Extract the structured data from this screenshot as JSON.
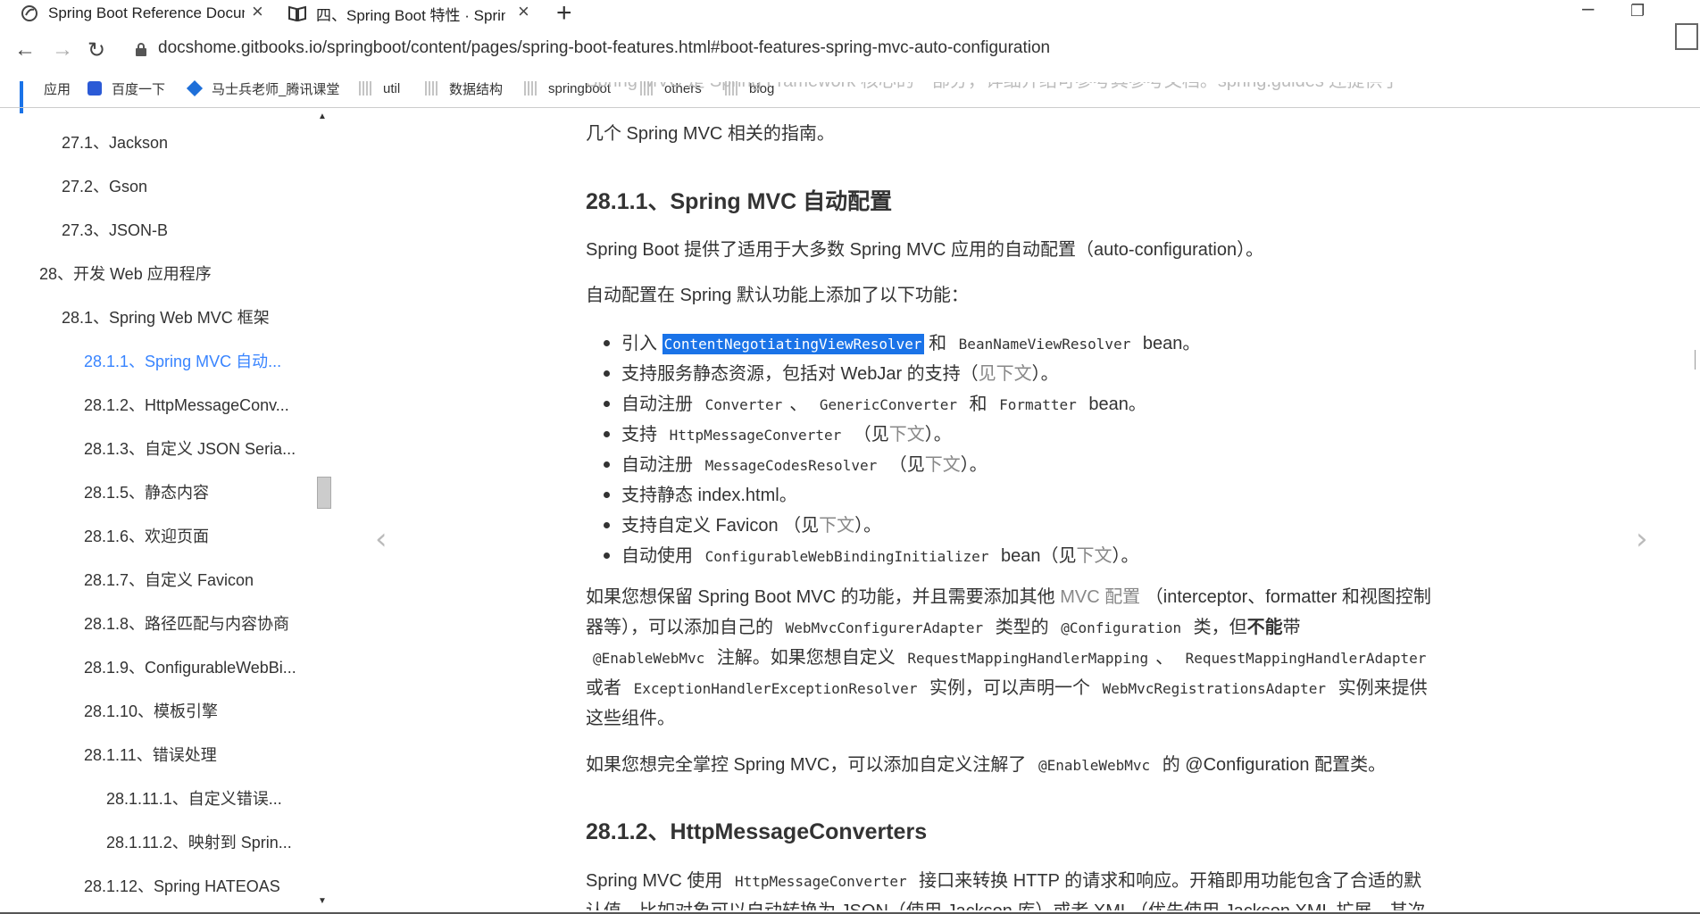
{
  "tabs": [
    {
      "title": "Spring Boot Reference Docum",
      "active": true
    },
    {
      "title": "四、Spring Boot 特性 · SpringI",
      "active": false
    }
  ],
  "address": "docshome.gitbooks.io/springboot/content/pages/spring-boot-features.html#boot-features-spring-mvc-auto-configuration",
  "bookmarks": [
    "应用",
    "百度一下",
    "马士兵老师_腾讯课堂",
    "util",
    "数据结构",
    "springboot",
    "others",
    "blog"
  ],
  "toc": [
    {
      "label": "27.1、Jackson",
      "level": 1
    },
    {
      "label": "27.2、Gson",
      "level": 1
    },
    {
      "label": "27.3、JSON-B",
      "level": 1
    },
    {
      "label": "28、开发 Web 应用程序",
      "level": 0
    },
    {
      "label": "28.1、Spring Web MVC 框架",
      "level": 1
    },
    {
      "label": "28.1.1、Spring MVC 自动...",
      "level": 2,
      "active": true
    },
    {
      "label": "28.1.2、HttpMessageConv...",
      "level": 2
    },
    {
      "label": "28.1.3、自定义 JSON Seria...",
      "level": 2
    },
    {
      "label": "28.1.5、静态内容",
      "level": 2
    },
    {
      "label": "28.1.6、欢迎页面",
      "level": 2
    },
    {
      "label": "28.1.7、自定义 Favicon",
      "level": 2
    },
    {
      "label": "28.1.8、路径匹配与内容协商",
      "level": 2
    },
    {
      "label": "28.1.9、ConfigurableWebBi...",
      "level": 2
    },
    {
      "label": "28.1.10、模板引擎",
      "level": 2
    },
    {
      "label": "28.1.11、错误处理",
      "level": 2
    },
    {
      "label": "28.1.11.1、自定义错误...",
      "level": 3
    },
    {
      "label": "28.1.11.2、映射到 Sprin...",
      "level": 3
    },
    {
      "label": "28.1.12、Spring HATEOAS",
      "level": 2
    }
  ],
  "content": {
    "intro_top": "Spring MVC 是 Spring Framework 核心的一部分，详细介绍可参考其参考文档。spring.guides 还提供了",
    "intro_line2": "几个 Spring MVC 相关的指南。",
    "h_auto": "28.1.1、Spring MVC 自动配置",
    "p_auto": "Spring Boot 提供了适用于大多数 Spring MVC 应用的自动配置（auto-configuration）。",
    "p_features": "自动配置在 Spring 默认功能上添加了以下功能：",
    "li1": {
      "pre": "引入",
      "code1": "ContentNegotiatingViewResolver",
      "mid": "和",
      "code2": "BeanNameViewResolver",
      "post": "bean。"
    },
    "li2": {
      "pre": "支持服务静态资源，包括对 WebJar 的支持（",
      "link": "见下文",
      "post": "）。"
    },
    "li3": {
      "pre": "自动注册",
      "code1": "Converter",
      "sep1": "、",
      "code2": "GenericConverter",
      "mid": "和",
      "code3": "Formatter",
      "post": "bean。"
    },
    "li4": {
      "pre": "支持",
      "code1": "HttpMessageConverter",
      "mid": "（见",
      "link": "下文",
      "post": "）。"
    },
    "li5": {
      "pre": "自动注册",
      "code1": "MessageCodesResolver",
      "mid": "（见",
      "link": "下文",
      "post": "）。"
    },
    "li6": "支持静态 index.html。",
    "li7": {
      "pre": "支持自定义 Favicon （见",
      "link": "下文",
      "post": "）。"
    },
    "li8": {
      "pre": "自动使用",
      "code1": "ConfigurableWebBindingInitializer",
      "mid": "bean（见",
      "link": "下文",
      "post": "）。"
    },
    "p_keep_l1a": "如果您想保留 Spring Boot MVC 的功能，并且需要添加其他",
    "p_keep_l1link": "MVC 配置",
    "p_keep_l1b": "（interceptor、formatter 和视图控制",
    "p_keep_l2a": "器等），可以添加自己的",
    "p_keep_l2code1": "WebMvcConfigurerAdapter",
    "p_keep_l2b": "类型的",
    "p_keep_l2code2": "@Configuration",
    "p_keep_l2c": "类，但",
    "p_keep_l2bold": "不能",
    "p_keep_l2d": "带",
    "p_keep_l3code1": "@EnableWebMvc",
    "p_keep_l3a": "注解。如果您想自定义",
    "p_keep_l3code2": "RequestMappingHandlerMapping",
    "p_keep_l3b": "、",
    "p_keep_l3code3": "RequestMappingHandlerAdapter",
    "p_keep_l4a": "或者",
    "p_keep_l4code1": "ExceptionHandlerExceptionResolver",
    "p_keep_l4b": "实例，可以声明一个",
    "p_keep_l4code2": "WebMvcRegistrationsAdapter",
    "p_keep_l4c": "实例来提供",
    "p_keep_l5": "这些组件。",
    "p_full_a": "如果您想完全掌控 Spring MVC，可以添加自定义注解了",
    "p_full_code": "@EnableWebMvc",
    "p_full_b": "的 @Configuration 配置类。",
    "h_conv": "28.1.2、HttpMessageConverters",
    "p_conv_a": "Spring MVC 使用",
    "p_conv_code": "HttpMessageConverter",
    "p_conv_b": "接口来转换 HTTP 的请求和响应。开箱即用功能包含了合适的默",
    "p_conv_l2": "认值，比如对象可以自动转换为 JSON（使用 Jackson 库）或者 XML（优先使用 Jackson XML 扩展，其次"
  },
  "colors": {
    "accent": "#3884ff",
    "selection": "#1a73e8",
    "text": "#333333"
  }
}
